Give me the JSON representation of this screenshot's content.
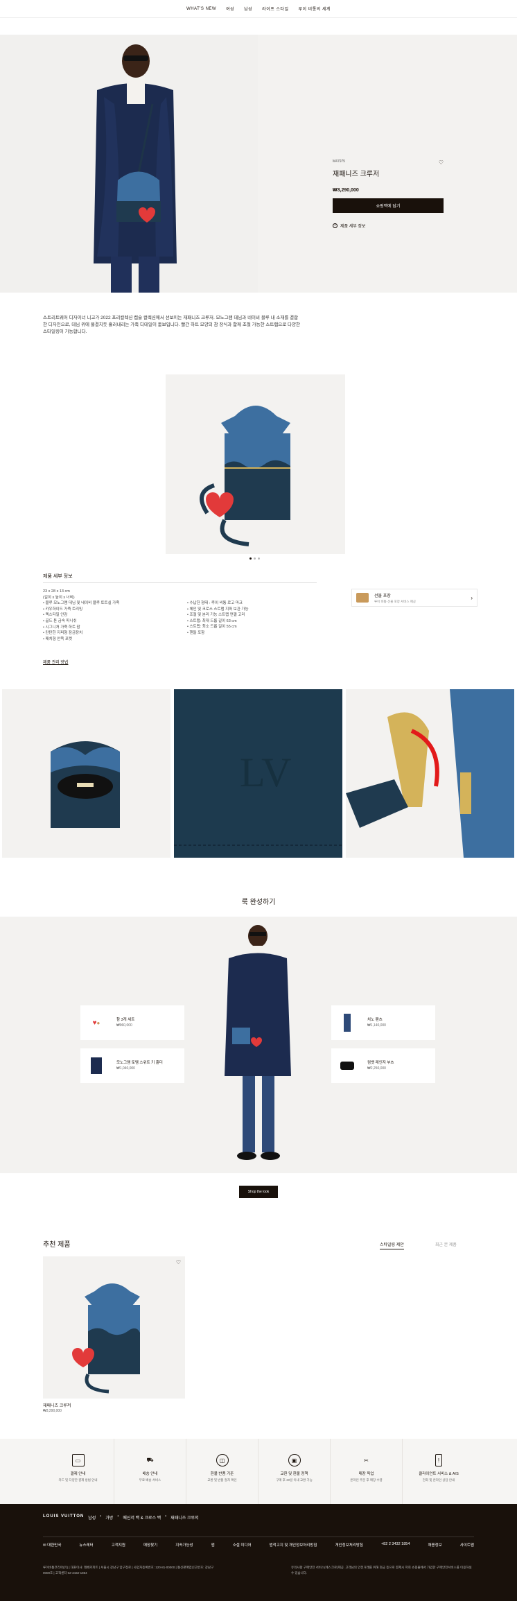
{
  "nav": [
    "WHAT'S NEW",
    "여성",
    "남성",
    "라이프 스타일",
    "루이 비통의 세계"
  ],
  "product": {
    "sku": "M47975",
    "title": "재패니즈 크루저",
    "price": "₩3,290,000",
    "cta": "쇼핑백에 담기",
    "details_link": "제품 세부 정보",
    "description": "스트리트웨어 디자이너 니고가 2022 프리컬렉션 캡슐 컬렉션에서 선보이는 재패니즈 크루저. 모노그램 데님과 네이비 블루 내 소재를 결합한 디자인으로, 데님 위에 물결치듯 흘러내리는 가죽 디테일이 돋보입니다. 빨간 하트 모양의 참 장식과 함께 조절 가능한 스트랩으로 다양한 스타일링이 가능합니다."
  },
  "gallery": {
    "dot_count": 3,
    "active_dot": 0
  },
  "specs": {
    "heading": "제품 세부 정보",
    "size": "23 x 28 x 13 cm",
    "size_note": "(길이 x 높이 x 너비)",
    "left": [
      "블루 모노그램 데님 및 네이비 블루 토트실 가죽",
      "카우하이드 가죽 트리밍",
      "텍스타일 안감",
      "골드 톤 금속 피니쉬",
      "시그니처 가죽 하트 참",
      "탄탄한 지퍼형 잠금장치",
      "패치형 안쪽 포켓"
    ],
    "right": [
      "수납한 형태 : 루이 비통 로고 마크",
      "체인 및 크로스 스트랩 지퍼 보관 가능",
      "조절 및 분리 가능 스트랩 연결 고리",
      "스트랩: 최대 드롭 길이 63 cm",
      "스트랩: 최소 드롭 길이 55 cm",
      "핸들 포함"
    ],
    "care_link": "제품 관리 방법"
  },
  "gift": {
    "title": "선물 포장",
    "desc": "루이 비통 선물 포장 서비스 제공"
  },
  "look": {
    "title": "룩 완성하기",
    "items": [
      {
        "name": "참 3개 세트",
        "price": "₩960,000"
      },
      {
        "name": "모노그램 토템 스위트 키 홀더",
        "price": "₩1,040,000"
      },
      {
        "name": "치노 팬츠",
        "price": "₩1,140,000"
      },
      {
        "name": "컴뱃 레인저 부츠",
        "price": "₩2,250,000"
      }
    ],
    "shop_label": "Shop the look"
  },
  "recommend": {
    "title": "추천 제품",
    "tabs": [
      "스타일링 제안",
      "최근 본 제품"
    ],
    "item": {
      "name": "재패니즈 크루저",
      "price": "₩3,290,000"
    }
  },
  "services": [
    {
      "icon": "card-icon",
      "title": "결제 안내",
      "desc": "카드 및 다양한 결제 방법 안내"
    },
    {
      "icon": "truck-icon",
      "title": "배송 안내",
      "desc": "무료 배송 서비스"
    },
    {
      "icon": "box-icon",
      "title": "환불 반품 기준",
      "desc": "교환 및 반품 절차 확인"
    },
    {
      "icon": "gift-box-icon",
      "title": "교환 및 환불 정책",
      "desc": "구매 후 30일 이내 교환 가능"
    },
    {
      "icon": "scissor-icon",
      "title": "매장 픽업",
      "desc": "온라인 주문 후 매장 수령"
    },
    {
      "icon": "phone-icon",
      "title": "클라이언트 서비스 & A/S",
      "desc": "전화 및 온라인 상담 안내"
    }
  ],
  "footer": {
    "brand": "LOUIS VUITTON",
    "breadcrumb": [
      "남성",
      "가방",
      "메신저 백 & 크로스 백",
      "재패니즈 크루저"
    ],
    "region": "대한민국",
    "links": [
      "뉴스레터",
      "고객지원",
      "매장찾기",
      "지속가능성",
      "앱",
      "소셜 미디어",
      "법적고지 및 개인정보처리방침",
      "개인정보처리방침",
      "+82 2 3432 1854",
      "채용정보",
      "사이트맵"
    ],
    "address": "루이비통코리아(유) | 대표이사: 레베카피트 | 서울시 강남구 압구정로 | 사업자등록번호: 120-81-00000 | 통신판매업신고번호: 강남구 0000호 | 고객센터 02-3432-1854",
    "note": "유의사항 구매안전 서비스(에스크로)제공. 고객님의 안전거래를 위해 현금 등으로 결제시 저희 쇼핑몰에서 가입한 구매안전서비스를 이용하실 수 있습니다."
  },
  "colors": {
    "ink": "#19110b",
    "panel": "#f3f2f0",
    "denim": "#35638f",
    "leather": "#1f3a4f",
    "heart": "#e23a3a"
  }
}
